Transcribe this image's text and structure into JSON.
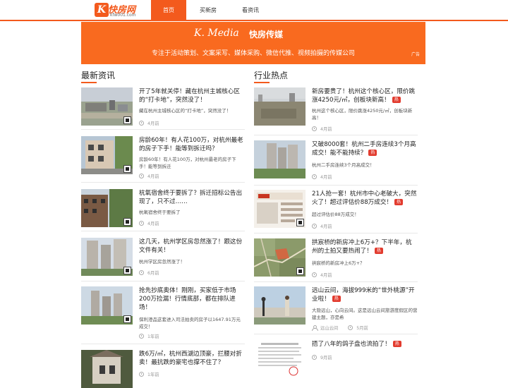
{
  "logo": {
    "mark": "K",
    "name": "快房网",
    "domain": "kfw001.com"
  },
  "nav": [
    {
      "label": "首页",
      "active": true
    },
    {
      "label": "买新房",
      "active": false
    },
    {
      "label": "看资讯",
      "active": false
    }
  ],
  "banner": {
    "signature": "K. Media",
    "title": "快房传媒",
    "subtitle": "专注于活动策划、文案采写、媒体采购、微信代推、视频拍摄的传媒公司",
    "ad_label": "广告"
  },
  "colors": {
    "accent": "#f35a1d",
    "banner": "#f96a1f",
    "hot_badge": "#e23b2e"
  },
  "left": {
    "title": "最新资讯",
    "items": [
      {
        "title": "开了5年就关停！藏在杭州主城核心区的“打卡地”，突然没了！",
        "desc": "藏在杭州主城核心区的“打卡地”，突然没了！",
        "time": "4月前",
        "icon": "clock-icon"
      },
      {
        "title": "房龄60年！有人花100万，对杭州最老的房子下手！能等到拆迁吗？",
        "desc": "房龄60年！有人花100万，对杭州最老的房子下手！能等到拆迁",
        "time": "4月前",
        "icon": "clock-icon"
      },
      {
        "title": "杭氧宿舍终于要拆了？拆迁招标公告出现了，只不过……",
        "desc": "杭氧宿舍终于要拆了",
        "time": "4月前",
        "icon": "clock-icon"
      },
      {
        "title": "这几天，杭州学区房忽然涨了！跟这份文件有关！",
        "desc": "杭州学区房忽然涨了！",
        "time": "6月前",
        "icon": "clock-icon"
      },
      {
        "title": "抢先抄底奥体！刚刚，买家低于市场200万捡漏！行情底部，都在排队进场！",
        "desc": "保利澄品这套进入司法拍卖的房子以1647.91万元成交！",
        "time": "1年前",
        "icon": "clock-icon"
      },
      {
        "title": "跌6万/㎡，杭州西湖边顶豪，拦腰对折卖！最抗跌的豪宅也撑不住了？",
        "desc": "",
        "time": "1年前",
        "icon": "clock-icon"
      }
    ]
  },
  "right": {
    "title": "行业热点",
    "items": [
      {
        "title": "新房要贵了！杭州这个核心区，限价跳涨4250元/㎡，创板块新高！",
        "hot": "热",
        "desc": "杭州这个核心区，限价跳涨4250元/㎡，创板块新高！",
        "time": "4月前",
        "author": ""
      },
      {
        "title": "又破8000套！杭州二手房连续3个月高成交！能不能持续？",
        "hot": "热",
        "desc": "杭州二手房连续3个月高成交！",
        "time": "4月前",
        "author": ""
      },
      {
        "title": "21人抢一套！杭州市中心老破大，突然火了！超过评估价88万成交！",
        "hot": "热",
        "desc": "超过评估价88万成交！",
        "time": "4月前",
        "author": ""
      },
      {
        "title": "拱宸桥的新房冲上6万+？下半年，杭州的土拍又要热闹了！",
        "hot": "热",
        "desc": "拱宸桥的新房冲上6万+？",
        "time": "4月前",
        "author": ""
      },
      {
        "title": "远山云间，海拔999米的“世外桃源”开业啦！",
        "hot": "热",
        "desc": "大隐远山，心向云间。这是远山云间旅游度假区的营建主题，亦是希",
        "time": "5月前",
        "author": "远山云间"
      },
      {
        "title": "捂了八年的鸽子盘也流拍了！",
        "hot": "热",
        "desc": "",
        "time": "9月前",
        "author": ""
      }
    ]
  }
}
